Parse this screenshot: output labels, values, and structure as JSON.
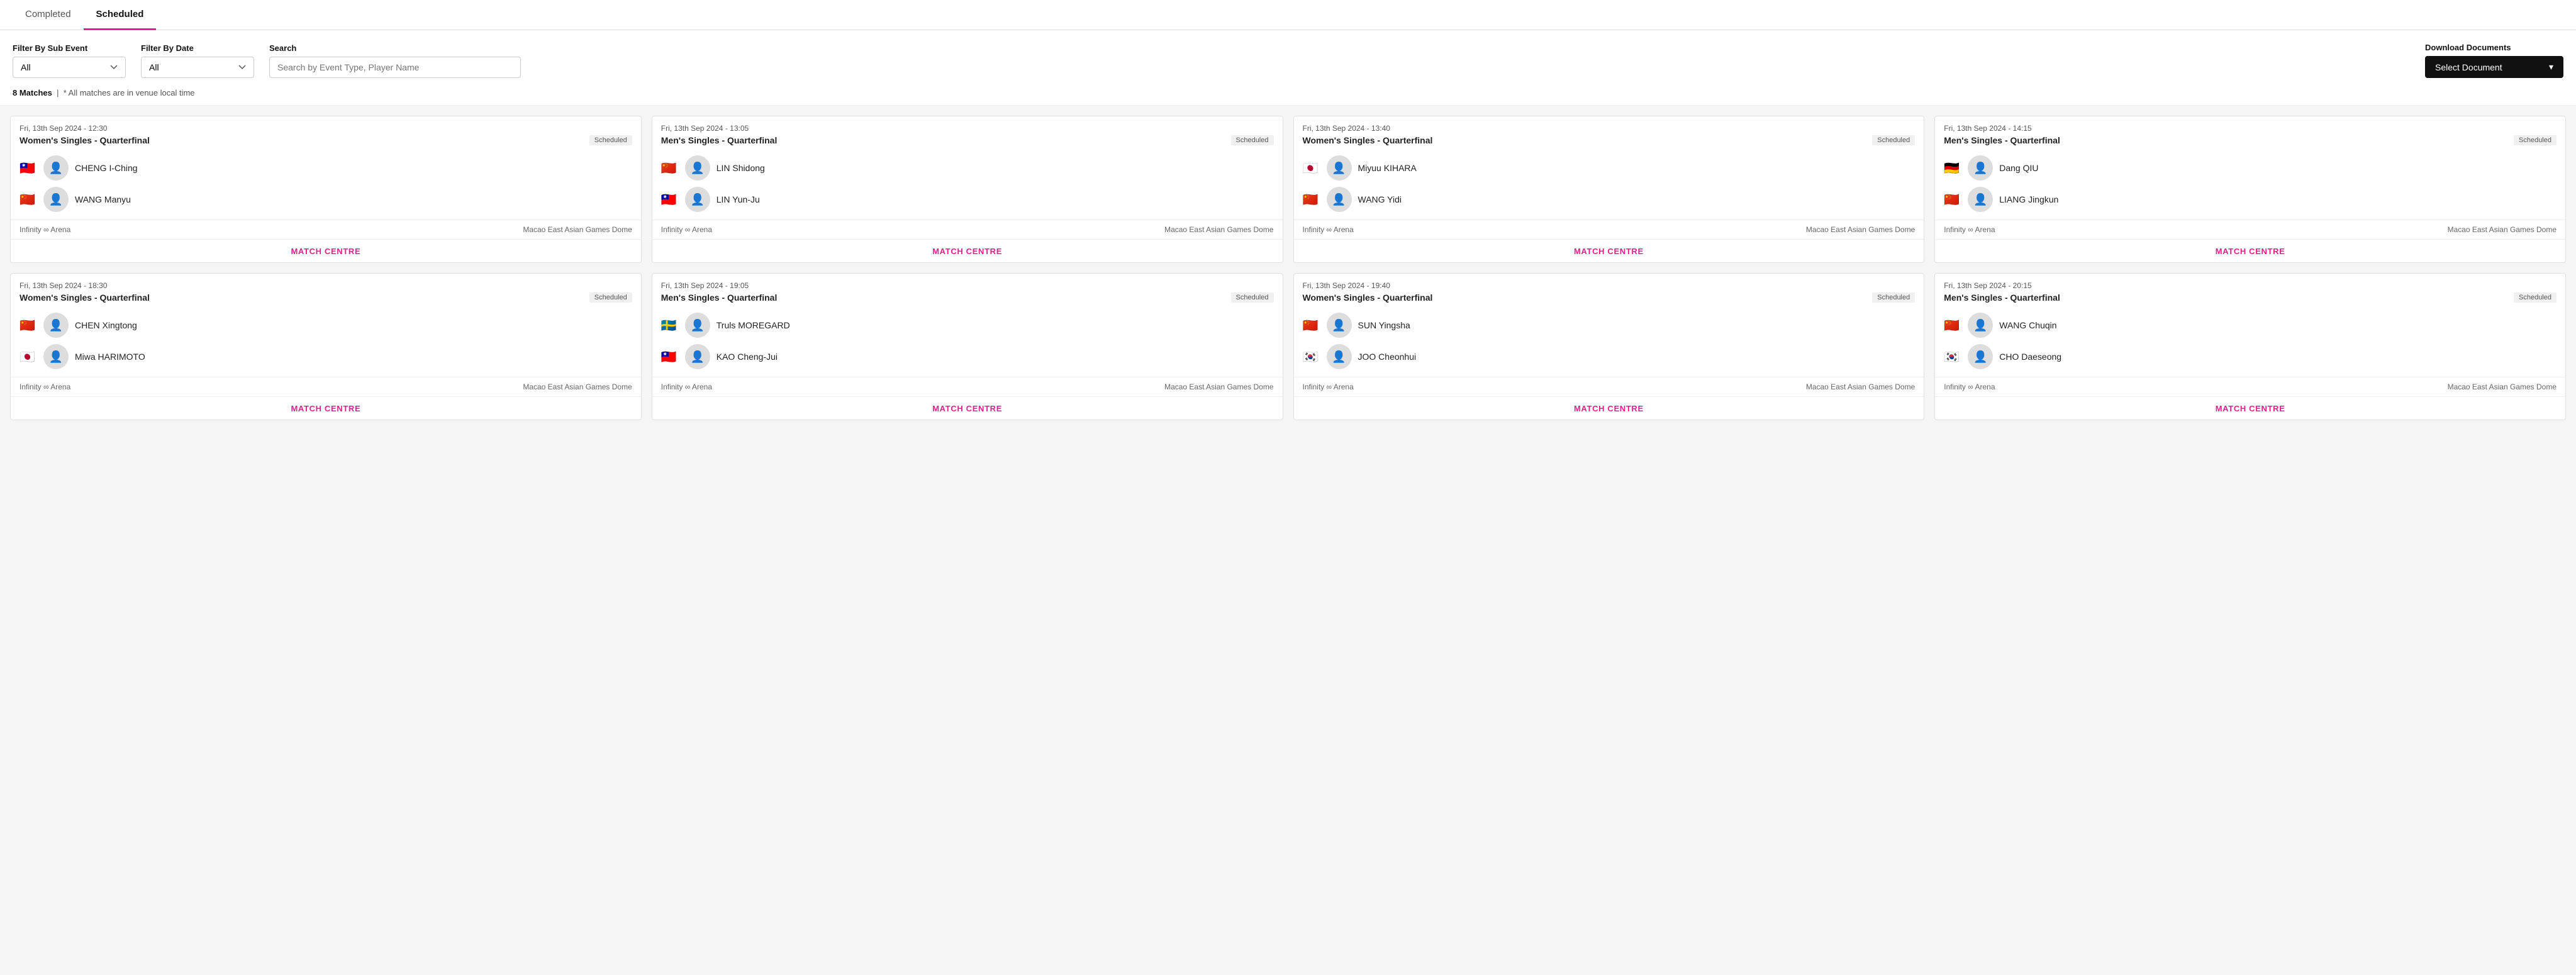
{
  "tabs": [
    {
      "id": "completed",
      "label": "Completed",
      "active": false
    },
    {
      "id": "scheduled",
      "label": "Scheduled",
      "active": true
    }
  ],
  "filters": {
    "subEvent": {
      "label": "Filter By Sub Event",
      "value": "All",
      "placeholder": "All"
    },
    "date": {
      "label": "Filter By Date",
      "value": "All",
      "placeholder": "All"
    },
    "search": {
      "label": "Search",
      "placeholder": "Search by Event Type, Player Name"
    },
    "download": {
      "label": "Download Documents",
      "buttonLabel": "Select Document"
    }
  },
  "matchCount": {
    "count": "8 Matches",
    "note": "* All matches are in venue local time"
  },
  "matches": [
    {
      "datetime": "Fri, 13th Sep 2024 - 12:30",
      "event": "Women's Singles - Quarterfinal",
      "status": "Scheduled",
      "players": [
        {
          "flag": "🇹🇼",
          "name": "CHENG I-Ching"
        },
        {
          "flag": "🇨🇳",
          "name": "WANG Manyu"
        }
      ],
      "venue": "Infinity ∞ Arena",
      "location": "Macao East Asian Games Dome",
      "matchCentreLabel": "MATCH CENTRE"
    },
    {
      "datetime": "Fri, 13th Sep 2024 - 13:05",
      "event": "Men's Singles - Quarterfinal",
      "status": "Scheduled",
      "players": [
        {
          "flag": "🇨🇳",
          "name": "LIN Shidong"
        },
        {
          "flag": "🇹🇼",
          "name": "LIN Yun-Ju"
        }
      ],
      "venue": "Infinity ∞ Arena",
      "location": "Macao East Asian Games Dome",
      "matchCentreLabel": "MATCH CENTRE"
    },
    {
      "datetime": "Fri, 13th Sep 2024 - 13:40",
      "event": "Women's Singles - Quarterfinal",
      "status": "Scheduled",
      "players": [
        {
          "flag": "🇯🇵",
          "name": "Miyuu KIHARA"
        },
        {
          "flag": "🇨🇳",
          "name": "WANG Yidi"
        }
      ],
      "venue": "Infinity ∞ Arena",
      "location": "Macao East Asian Games Dome",
      "matchCentreLabel": "MATCH CENTRE"
    },
    {
      "datetime": "Fri, 13th Sep 2024 - 14:15",
      "event": "Men's Singles - Quarterfinal",
      "status": "Scheduled",
      "players": [
        {
          "flag": "🇩🇪",
          "name": "Dang QIU"
        },
        {
          "flag": "🇨🇳",
          "name": "LIANG Jingkun"
        }
      ],
      "venue": "Infinity ∞ Arena",
      "location": "Macao East Asian Games Dome",
      "matchCentreLabel": "MATCH CENTRE"
    },
    {
      "datetime": "Fri, 13th Sep 2024 - 18:30",
      "event": "Women's Singles - Quarterfinal",
      "status": "Scheduled",
      "players": [
        {
          "flag": "🇨🇳",
          "name": "CHEN Xingtong"
        },
        {
          "flag": "🇯🇵",
          "name": "Miwa HARIMOTO"
        }
      ],
      "venue": "Infinity ∞ Arena",
      "location": "Macao East Asian Games Dome",
      "matchCentreLabel": "MATCH CENTRE"
    },
    {
      "datetime": "Fri, 13th Sep 2024 - 19:05",
      "event": "Men's Singles - Quarterfinal",
      "status": "Scheduled",
      "players": [
        {
          "flag": "🇸🇪",
          "name": "Truls MOREGARD"
        },
        {
          "flag": "🇹🇼",
          "name": "KAO Cheng-Jui"
        }
      ],
      "venue": "Infinity ∞ Arena",
      "location": "Macao East Asian Games Dome",
      "matchCentreLabel": "MATCH CENTRE"
    },
    {
      "datetime": "Fri, 13th Sep 2024 - 19:40",
      "event": "Women's Singles - Quarterfinal",
      "status": "Scheduled",
      "players": [
        {
          "flag": "🇨🇳",
          "name": "SUN Yingsha"
        },
        {
          "flag": "🇰🇷",
          "name": "JOO Cheonhui"
        }
      ],
      "venue": "Infinity ∞ Arena",
      "location": "Macao East Asian Games Dome",
      "matchCentreLabel": "MATCH CENTRE"
    },
    {
      "datetime": "Fri, 13th Sep 2024 - 20:15",
      "event": "Men's Singles - Quarterfinal",
      "status": "Scheduled",
      "players": [
        {
          "flag": "🇨🇳",
          "name": "WANG Chuqin"
        },
        {
          "flag": "🇰🇷",
          "name": "CHO Daeseong"
        }
      ],
      "venue": "Infinity ∞ Arena",
      "location": "Macao East Asian Games Dome",
      "matchCentreLabel": "MATCH CENTRE"
    }
  ]
}
